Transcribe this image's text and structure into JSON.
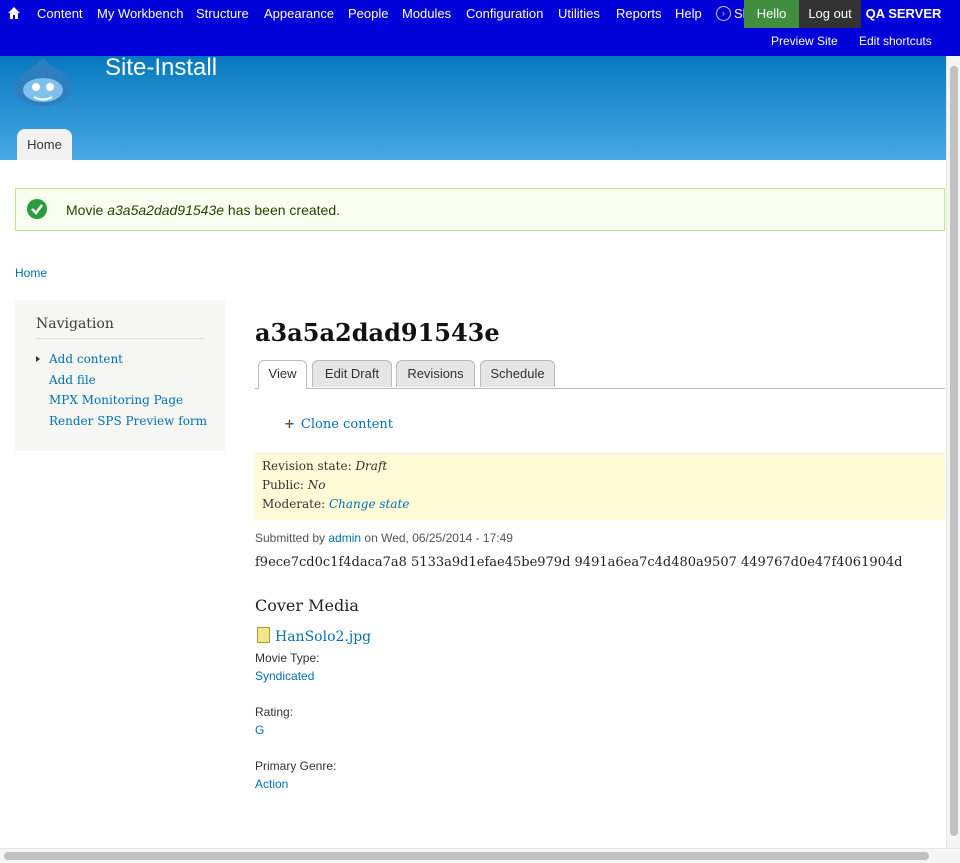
{
  "toolbar": {
    "menu": [
      "Content",
      "My Workbench",
      "Structure",
      "Appearance",
      "People",
      "Modules",
      "Configuration",
      "Utilities",
      "Reports",
      "Help"
    ],
    "shortcuts_label": "Shortcuts",
    "hello_label": "Hello",
    "logout_label": "Log out",
    "server_label": "QA SERVER",
    "preview_site": "Preview Site",
    "edit_shortcuts": "Edit shortcuts"
  },
  "header": {
    "site_name": "Site-Install",
    "home_tab": "Home"
  },
  "status": {
    "prefix": "Movie ",
    "title": "a3a5a2dad91543e",
    "suffix": " has been created."
  },
  "breadcrumb": "Home",
  "sidebar": {
    "title": "Navigation",
    "items": [
      "Add content",
      "Add file",
      "MPX Monitoring Page",
      "Render SPS Preview form"
    ]
  },
  "node": {
    "title": "a3a5a2dad91543e",
    "tabs": [
      "View",
      "Edit Draft",
      "Revisions",
      "Schedule"
    ],
    "clone_label": "Clone content",
    "revision_state_label": "Revision state: ",
    "revision_state_value": "Draft",
    "public_label": "Public: ",
    "public_value": "No",
    "moderate_label": "Moderate: ",
    "moderate_link": "Change state",
    "submitted_by": "Submitted by ",
    "author": "admin",
    "submitted_on": " on Wed, 06/25/2014 - 17:49",
    "hashes": "f9ece7cd0c1f4daca7a8 5133a9d1efae45be979d 9491a6ea7c4d480a9507 449767d0e47f4061904d",
    "cover_media_title": "Cover Media",
    "file_name": "HanSolo2.jpg",
    "movie_type_label": "Movie Type:",
    "movie_type_value": "Syndicated",
    "rating_label": "Rating:",
    "rating_value": "G",
    "genre_label": "Primary Genre:",
    "genre_value": "Action"
  },
  "colors": {
    "toolbar": "#0000d8",
    "link": "#0071b3",
    "status_bg": "#f8fff0",
    "moderation_bg": "#fffbd6"
  }
}
